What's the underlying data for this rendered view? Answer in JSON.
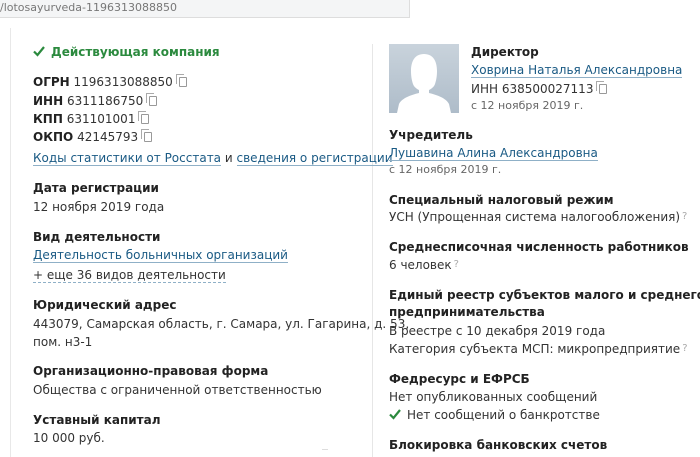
{
  "url": "/lotosayurveda-1196313088850",
  "left": {
    "status": "Действующая компания",
    "ogrn": {
      "label": "ОГРН",
      "value": "1196313088850"
    },
    "inn": {
      "label": "ИНН",
      "value": "6311186750"
    },
    "kpp": {
      "label": "КПП",
      "value": "631101001"
    },
    "okpo": {
      "label": "ОКПО",
      "value": "42145793"
    },
    "codes_link": "Коды статистики от Росстата",
    "codes_and": "и",
    "reg_link": "сведения о регистрации",
    "reg_date_title": "Дата регистрации",
    "reg_date": "12 ноября 2019 года",
    "activity_title": "Вид деятельности",
    "activity_link": "Деятельность больничных организаций",
    "activity_more": "+ еще 36 видов деятельности",
    "address_title": "Юридический адрес",
    "address_line1": "443079, Самарская область, г. Самара, ул. Гагарина, д. 53,",
    "address_line2": "пом. н3-1",
    "form_title": "Организационно-правовая форма",
    "form_value": "Общества с ограниченной ответственностью",
    "capital_title": "Уставный капитал",
    "capital_value": "10 000 руб."
  },
  "right": {
    "director_title": "Директор",
    "director_name": "Ховрина Наталья Александровна",
    "director_inn": "ИНН 638500027113",
    "director_since": "с 12 ноября 2019 г.",
    "founder_title": "Учредитель",
    "founder_name": "Лушавина Алина Александровна",
    "founder_since": "с 12 ноября 2019 г.",
    "tax_title": "Специальный налоговый режим",
    "tax_value": "УСН (Упрощенная система налогообложения)",
    "staff_title": "Среднесписочная численность работников",
    "staff_value": "6 человек",
    "registry_title_line1": "Единый реестр субъектов малого и среднего",
    "registry_title_line2": "предпринимательства",
    "registry_since": "В реестре с 10 декабря 2019 года",
    "registry_category": "Категория субъекта МСП: микропредприятие",
    "fedresurs_title": "Федресурс и ЕФРСБ",
    "fedresurs_value": "Нет опубликованных сообщений",
    "bankruptcy": "Нет сообщений о банкротстве",
    "block_title": "Блокировка банковских счетов"
  },
  "icons": {
    "help": "?"
  },
  "colors": {
    "link": "#1a5a84",
    "status_green": "#2b8a3e"
  }
}
